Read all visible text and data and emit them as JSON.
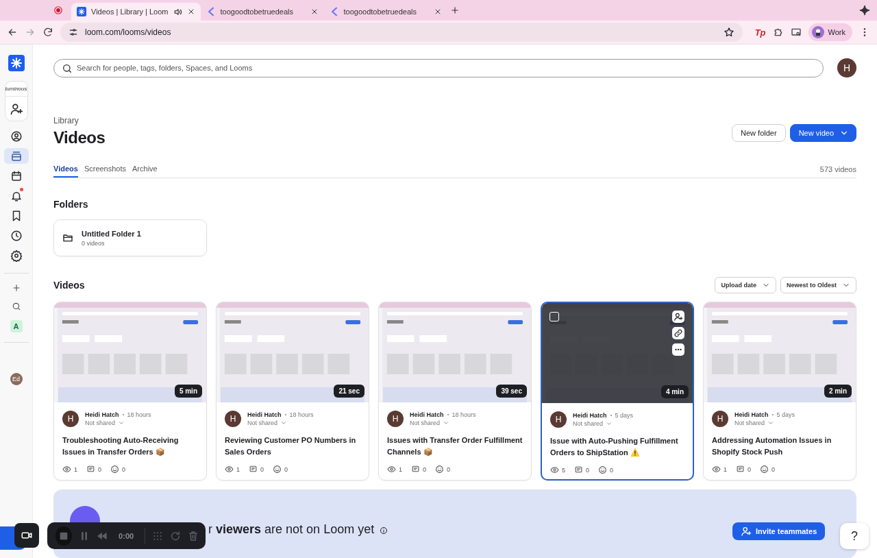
{
  "browser": {
    "tabs": [
      {
        "title": "Videos | Library | Loom",
        "selected": true,
        "audio": true,
        "kind": "loom"
      },
      {
        "title": "toogoodtobetruedeals",
        "selected": false,
        "audio": false,
        "kind": "deals"
      },
      {
        "title": "toogoodtobetruedeals",
        "selected": false,
        "audio": false,
        "kind": "deals"
      }
    ],
    "url": "loom.com/looms/videos",
    "extension": "Tp",
    "profile": "Work"
  },
  "sidebar": {
    "workspace": "luminous",
    "items": [
      {
        "selected": false,
        "badge": false
      },
      {
        "selected": true,
        "badge": false
      },
      {
        "selected": false,
        "badge": false
      },
      {
        "selected": false,
        "badge": true
      },
      {
        "selected": false,
        "badge": false
      },
      {
        "selected": false,
        "badge": false
      },
      {
        "selected": false,
        "badge": false
      }
    ],
    "space": "A",
    "user": "Ed"
  },
  "search": {
    "placeholder": "Search for people, tags, folders, Spaces, and Looms"
  },
  "avatar": "H",
  "breadcrumb": "Library",
  "title": "Videos",
  "actions": {
    "new_folder": "New folder",
    "new_video": "New video"
  },
  "tabs": [
    {
      "label": "Videos",
      "selected": true
    },
    {
      "label": "Screenshots",
      "selected": false
    },
    {
      "label": "Archive",
      "selected": false
    }
  ],
  "count": "573 videos",
  "folders": {
    "heading": "Folders",
    "items": [
      {
        "name": "Untitled Folder 1",
        "count": "0 videos"
      }
    ]
  },
  "videos": {
    "heading": "Videos",
    "sort": [
      "Upload date",
      "Newest to Oldest"
    ],
    "items": [
      {
        "duration": "5 min",
        "author": "Heidi Hatch",
        "initial": "H",
        "age": "18 hours",
        "sharing": "Not shared",
        "title": "Troubleshooting Auto-Receiving Issues in Transfer Orders 📦",
        "views": "1",
        "comments": "0",
        "reactions": "0",
        "selected": false
      },
      {
        "duration": "21 sec",
        "author": "Heidi Hatch",
        "initial": "H",
        "age": "18 hours",
        "sharing": "Not shared",
        "title": "Reviewing Customer PO Numbers in Sales Orders",
        "views": "1",
        "comments": "0",
        "reactions": "0",
        "selected": false
      },
      {
        "duration": "39 sec",
        "author": "Heidi Hatch",
        "initial": "H",
        "age": "18 hours",
        "sharing": "Not shared",
        "title": "Issues with Transfer Order Fulfillment Channels 📦",
        "views": "1",
        "comments": "0",
        "reactions": "0",
        "selected": false
      },
      {
        "duration": "4 min",
        "author": "Heidi Hatch",
        "initial": "H",
        "age": "5 days",
        "sharing": "Not shared",
        "title": "Issue with Auto-Pushing Fulfillment Orders to ShipStation ⚠️",
        "views": "5",
        "comments": "0",
        "reactions": "0",
        "selected": true
      },
      {
        "duration": "2 min",
        "author": "Heidi Hatch",
        "initial": "H",
        "age": "5 days",
        "sharing": "Not shared",
        "title": "Addressing Automation Issues in Shopify Stock Push",
        "views": "1",
        "comments": "0",
        "reactions": "0",
        "selected": false
      }
    ]
  },
  "banner": {
    "text": "r **viewers** are not on Loom yet",
    "invite": "Invite teammates"
  },
  "help": "?",
  "recorder": {
    "time": "0:00"
  }
}
